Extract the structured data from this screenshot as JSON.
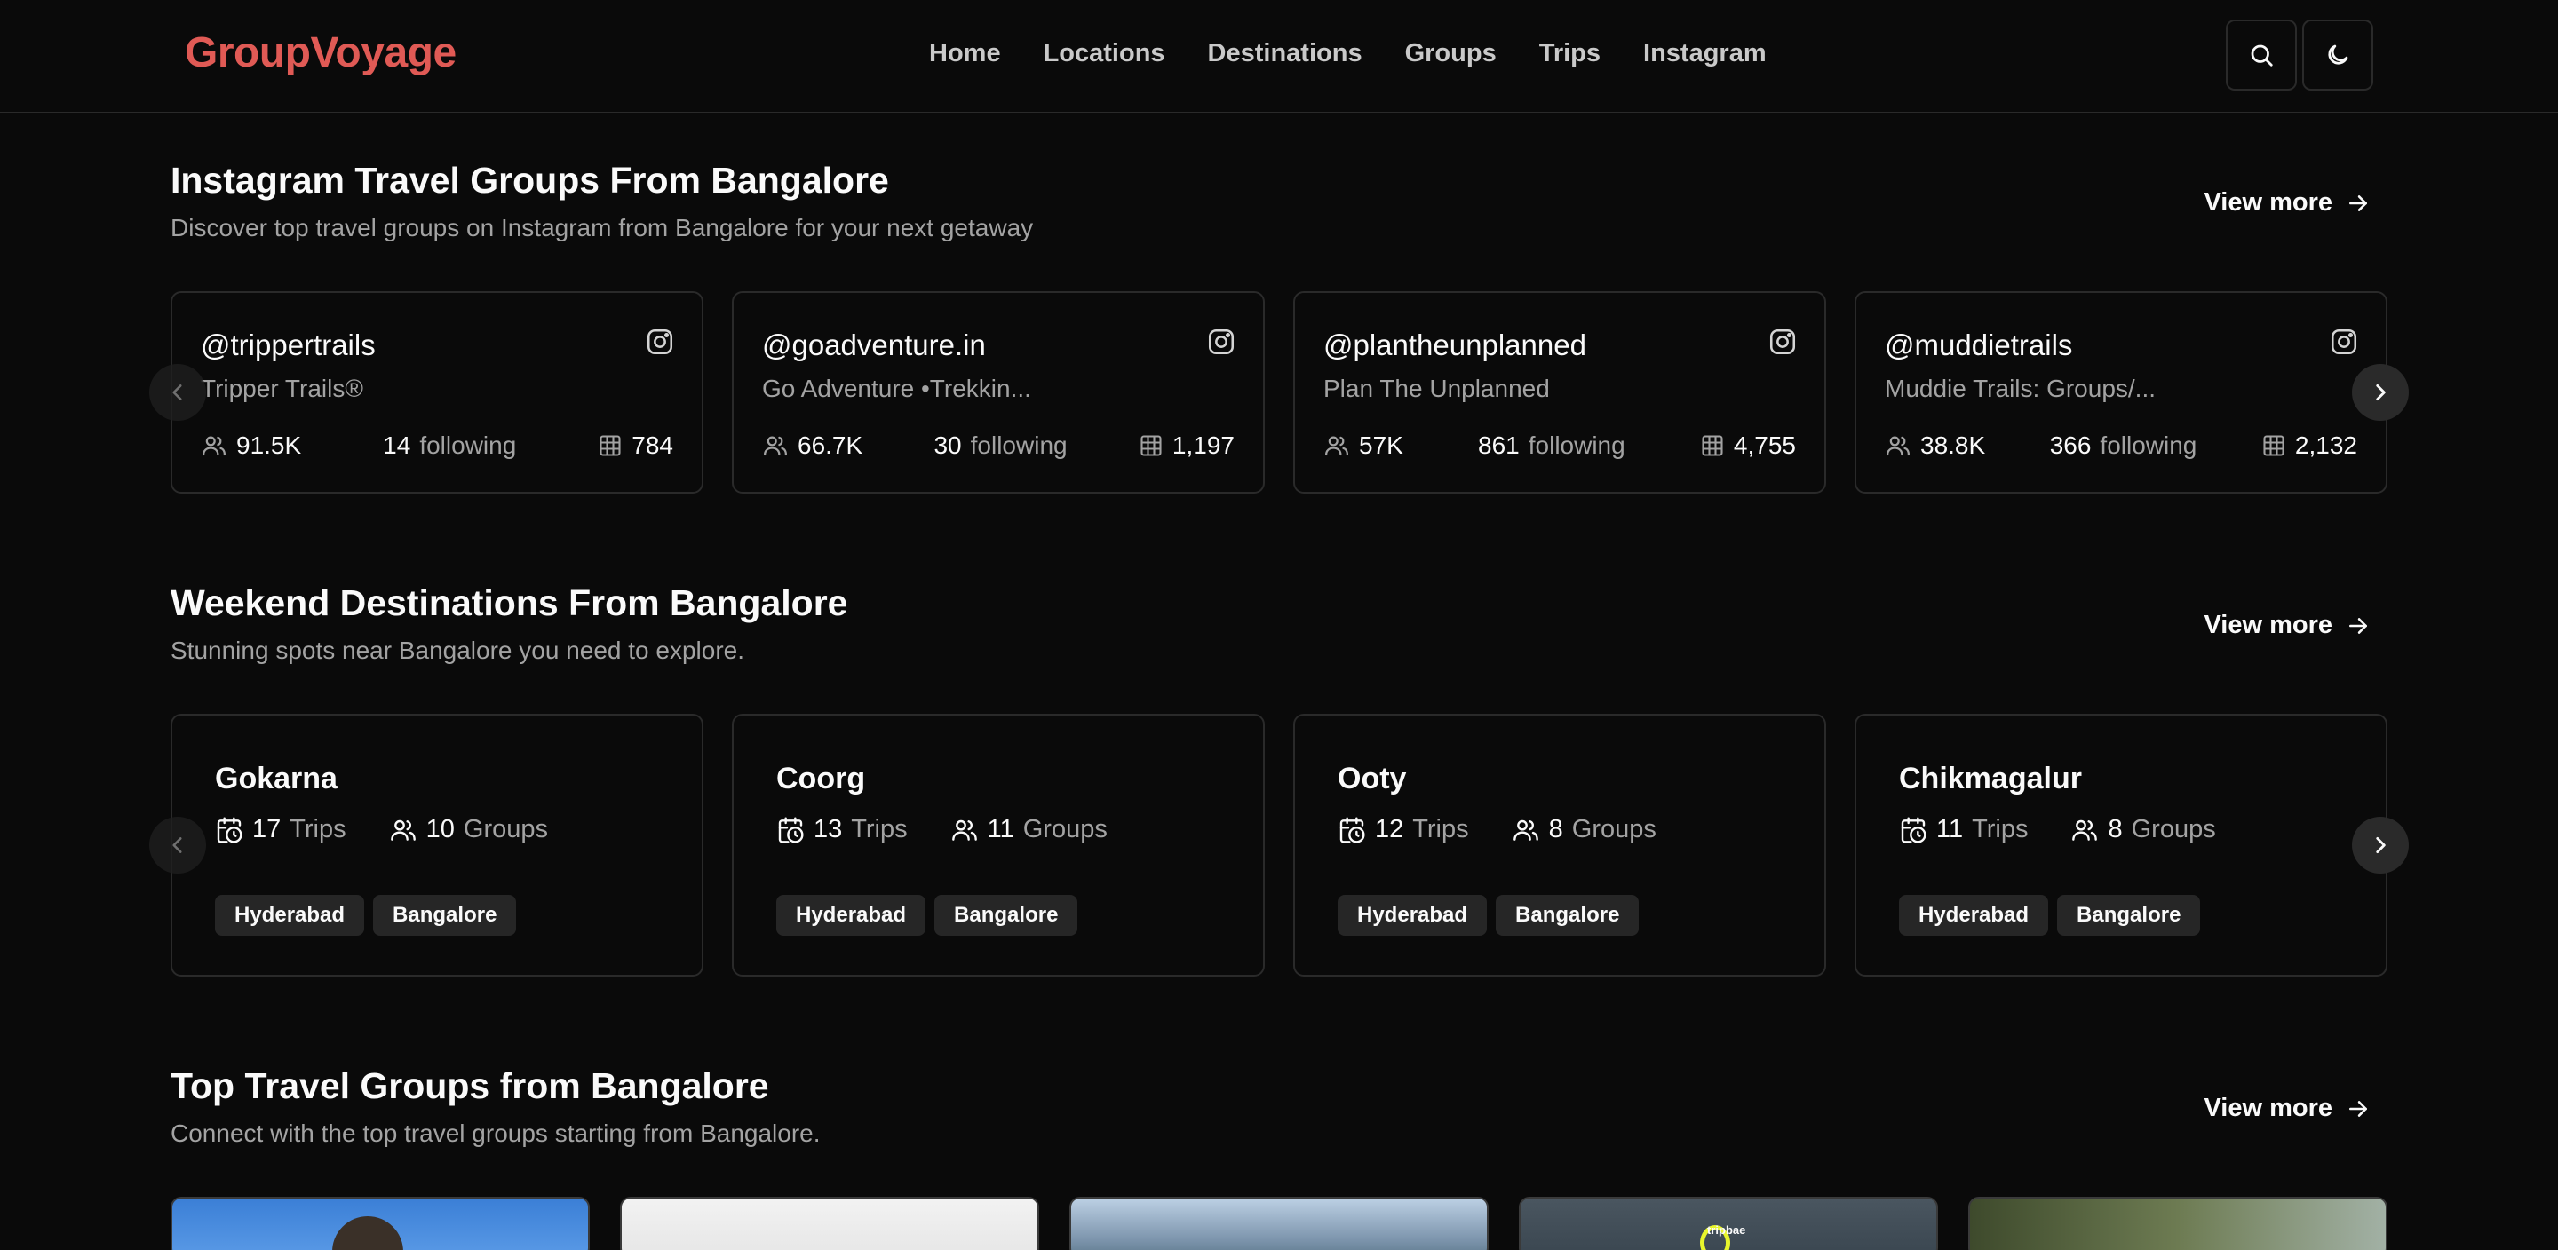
{
  "header": {
    "logo": "GroupVoyage",
    "nav": [
      "Home",
      "Locations",
      "Destinations",
      "Groups",
      "Trips",
      "Instagram"
    ],
    "brand_color": "#e05a55"
  },
  "instagram_section": {
    "title": "Instagram Travel Groups From Bangalore",
    "subtitle": "Discover top travel groups on Instagram from Bangalore for your next getaway",
    "view_more": "View more",
    "cards": [
      {
        "handle": "@trippertrails",
        "name": "Tripper Trails®",
        "followers": "91.5K",
        "following_count": "14",
        "following_label": "following",
        "posts": "784"
      },
      {
        "handle": "@goadventure.in",
        "name": "Go Adventure •Trekkin...",
        "followers": "66.7K",
        "following_count": "30",
        "following_label": "following",
        "posts": "1,197"
      },
      {
        "handle": "@plantheunplanned",
        "name": "Plan The Unplanned",
        "followers": "57K",
        "following_count": "861",
        "following_label": "following",
        "posts": "4,755"
      },
      {
        "handle": "@muddietrails",
        "name": "Muddie Trails: Groups/...",
        "followers": "38.8K",
        "following_count": "366",
        "following_label": "following",
        "posts": "2,132"
      }
    ]
  },
  "destinations_section": {
    "title": "Weekend Destinations From Bangalore",
    "subtitle": "Stunning spots near Bangalore you need to explore.",
    "view_more": "View more",
    "cards": [
      {
        "name": "Gokarna",
        "trips": "17",
        "trips_label": "Trips",
        "groups": "10",
        "groups_label": "Groups",
        "tags": [
          "Hyderabad",
          "Bangalore"
        ]
      },
      {
        "name": "Coorg",
        "trips": "13",
        "trips_label": "Trips",
        "groups": "11",
        "groups_label": "Groups",
        "tags": [
          "Hyderabad",
          "Bangalore"
        ]
      },
      {
        "name": "Ooty",
        "trips": "12",
        "trips_label": "Trips",
        "groups": "8",
        "groups_label": "Groups",
        "tags": [
          "Hyderabad",
          "Bangalore"
        ]
      },
      {
        "name": "Chikmagalur",
        "trips": "11",
        "trips_label": "Trips",
        "groups": "8",
        "groups_label": "Groups",
        "tags": [
          "Hyderabad",
          "Bangalore"
        ]
      }
    ]
  },
  "groups_section": {
    "title": "Top Travel Groups from Bangalore",
    "subtitle": "Connect with the top travel groups starting from Bangalore.",
    "view_more": "View more",
    "thumb_text": "tripbae"
  }
}
